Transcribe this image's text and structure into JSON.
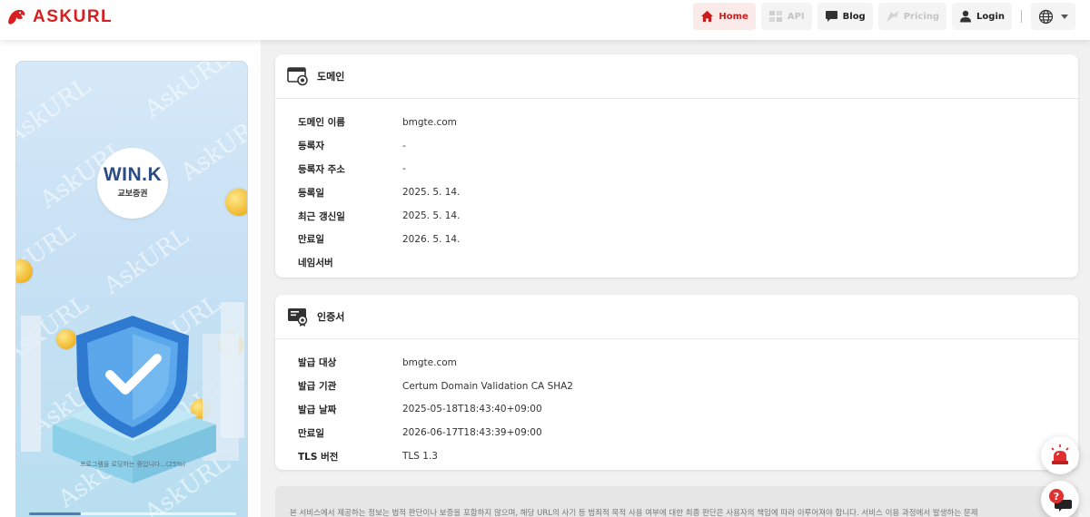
{
  "brand": {
    "name": "ASKURL",
    "icon": "dragon-logo-icon"
  },
  "nav": {
    "items": [
      {
        "label": "Home",
        "icon": "home-icon",
        "state": "active"
      },
      {
        "label": "API",
        "icon": "api-icon",
        "state": "disabled"
      },
      {
        "label": "Blog",
        "icon": "chat-bubble-icon",
        "state": "normal"
      },
      {
        "label": "Pricing",
        "icon": "pricing-icon",
        "state": "disabled"
      },
      {
        "label": "Login",
        "icon": "user-icon",
        "state": "normal"
      }
    ],
    "language_icon": "globe-icon"
  },
  "preview": {
    "watermark": "AskURL",
    "logo_main": "WIN.K",
    "logo_sub": "교보증권",
    "loading_text": "프로그램을 로딩하는 중입니다...(25%)",
    "progress": 0.25
  },
  "domain_card": {
    "title": "도메인",
    "icon": "domain-browser-icon",
    "rows": [
      {
        "label": "도메인 이름",
        "value": "bmgte.com"
      },
      {
        "label": "등록자",
        "value": "-"
      },
      {
        "label": "등록자 주소",
        "value": "-"
      },
      {
        "label": "등록일",
        "value": "2025. 5. 14."
      },
      {
        "label": "최근 갱신일",
        "value": "2025. 5. 14."
      },
      {
        "label": "만료일",
        "value": "2026. 5. 14."
      },
      {
        "label": "네임서버",
        "value": ""
      }
    ]
  },
  "cert_card": {
    "title": "인증서",
    "icon": "certificate-icon",
    "rows": [
      {
        "label": "발급 대상",
        "value": "bmgte.com"
      },
      {
        "label": "발급 기관",
        "value": "Certum Domain Validation CA SHA2"
      },
      {
        "label": "발급 날짜",
        "value": "2025-05-18T18:43:40+09:00"
      },
      {
        "label": "만료일",
        "value": "2026-06-17T18:43:39+09:00"
      },
      {
        "label": "TLS 버전",
        "value": "TLS 1.3"
      }
    ]
  },
  "disclaimer": "본 서비스에서 제공하는 정보는 법적 판단이나 보증을 포함하지 않으며, 해당 URL의 사기 등 범죄적 목적 사용 여부에 대한 최종 판단은 사용자의 책임에 따라 이루어져야 합니다. 서비스 이용 과정에서 발생하는 문제",
  "floating": [
    {
      "icon": "siren-alarm-icon"
    },
    {
      "icon": "help-chat-icon"
    }
  ],
  "colors": {
    "brand_red": "#d81e1e",
    "active_nav_bg": "#fbeaea"
  }
}
